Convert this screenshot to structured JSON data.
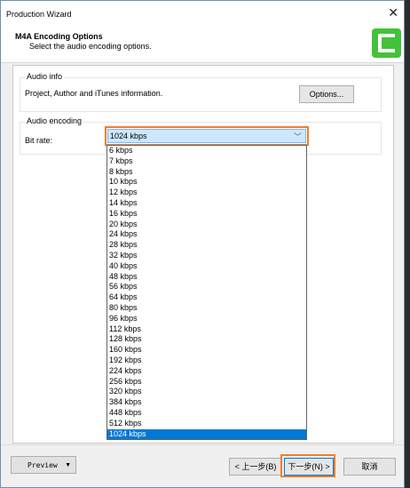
{
  "window": {
    "title": "Production Wizard",
    "close_glyph": "✕"
  },
  "header": {
    "title": "M4A Encoding Options",
    "subtitle": "Select the audio encoding options.",
    "logo_icon": "camtasia-logo-icon",
    "logo_color": "#43c23a"
  },
  "audio_info": {
    "legend": "Audio info",
    "description": "Project, Author and iTunes information.",
    "options_button": "Options..."
  },
  "audio_encoding": {
    "legend": "Audio encoding",
    "bitrate_label": "Bit rate:",
    "selected": "1024 kbps",
    "options": [
      "6 kbps",
      "7 kbps",
      "8 kbps",
      "10 kbps",
      "12 kbps",
      "14 kbps",
      "16 kbps",
      "20 kbps",
      "24 kbps",
      "28 kbps",
      "32 kbps",
      "40 kbps",
      "48 kbps",
      "56 kbps",
      "64 kbps",
      "80 kbps",
      "96 kbps",
      "112 kbps",
      "128 kbps",
      "160 kbps",
      "192 kbps",
      "224 kbps",
      "256 kbps",
      "320 kbps",
      "384 kbps",
      "448 kbps",
      "512 kbps",
      "1024 kbps"
    ]
  },
  "footer": {
    "preview_button": "Preview",
    "back_button": "< 上一步(B)",
    "next_button": "下一步(N) >",
    "cancel_button": "取消"
  },
  "highlight_color": "#f07e2d"
}
